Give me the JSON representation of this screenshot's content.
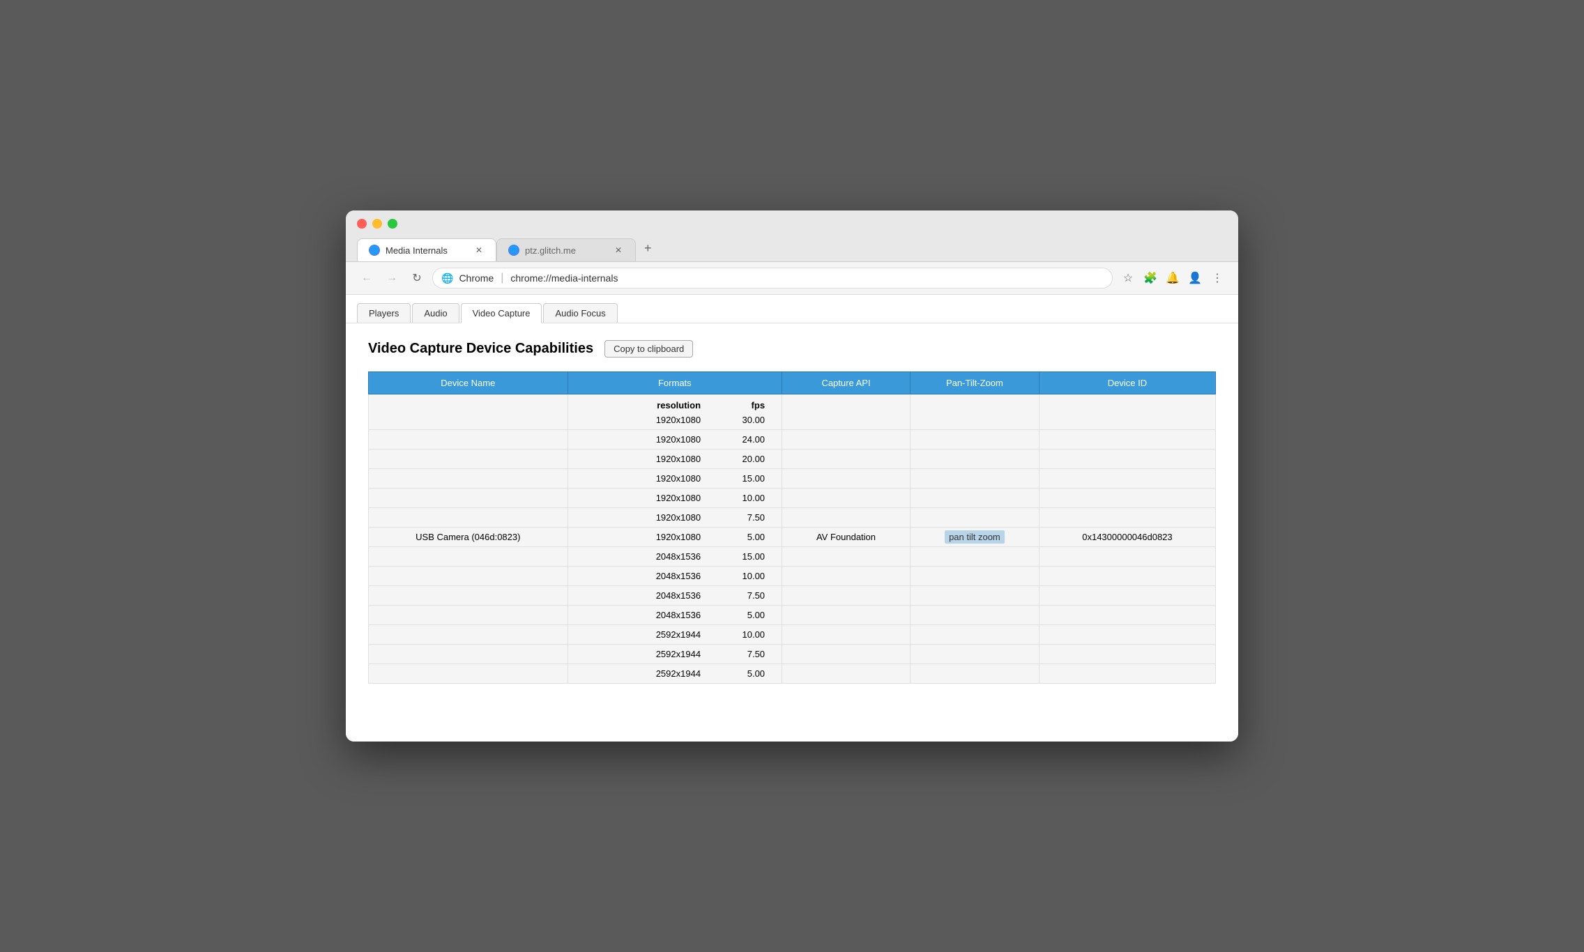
{
  "window": {
    "traffic_lights": {
      "red": "red",
      "yellow": "yellow",
      "green": "green"
    }
  },
  "tabs": [
    {
      "label": "Media Internals",
      "active": true,
      "icon": "🌐"
    },
    {
      "label": "ptz.glitch.me",
      "active": false,
      "icon": "🌐"
    }
  ],
  "new_tab_label": "+",
  "toolbar": {
    "back_title": "Back",
    "forward_title": "Forward",
    "reload_title": "Reload",
    "address_icon": "🌐",
    "address_label": "Chrome",
    "address_separator": "|",
    "address_url": "chrome://media-internals",
    "star_title": "Bookmark",
    "extensions_title": "Extensions",
    "profile_title": "Profile",
    "more_title": "More"
  },
  "nav_tabs": [
    {
      "label": "Players",
      "active": false
    },
    {
      "label": "Audio",
      "active": false
    },
    {
      "label": "Video Capture",
      "active": true
    },
    {
      "label": "Audio Focus",
      "active": false
    }
  ],
  "section": {
    "title": "Video Capture Device Capabilities",
    "copy_button": "Copy to clipboard"
  },
  "table": {
    "headers": [
      "Device Name",
      "Formats",
      "Capture API",
      "Pan-Tilt-Zoom",
      "Device ID"
    ],
    "format_headers": [
      "resolution",
      "fps"
    ],
    "device_name": "USB Camera (046d:0823)",
    "formats": [
      {
        "resolution": "1920x1080",
        "fps": "30.00"
      },
      {
        "resolution": "1920x1080",
        "fps": "24.00"
      },
      {
        "resolution": "1920x1080",
        "fps": "20.00"
      },
      {
        "resolution": "1920x1080",
        "fps": "15.00"
      },
      {
        "resolution": "1920x1080",
        "fps": "10.00"
      },
      {
        "resolution": "1920x1080",
        "fps": "7.50"
      },
      {
        "resolution": "1920x1080",
        "fps": "5.00"
      },
      {
        "resolution": "2048x1536",
        "fps": "15.00"
      },
      {
        "resolution": "2048x1536",
        "fps": "10.00"
      },
      {
        "resolution": "2048x1536",
        "fps": "7.50"
      },
      {
        "resolution": "2048x1536",
        "fps": "5.00"
      },
      {
        "resolution": "2592x1944",
        "fps": "10.00"
      },
      {
        "resolution": "2592x1944",
        "fps": "7.50"
      },
      {
        "resolution": "2592x1944",
        "fps": "5.00"
      }
    ],
    "capture_api": "AV Foundation",
    "ptz": "pan tilt zoom",
    "device_id": "0x14300000046d0823",
    "ptz_row_index": 6
  }
}
